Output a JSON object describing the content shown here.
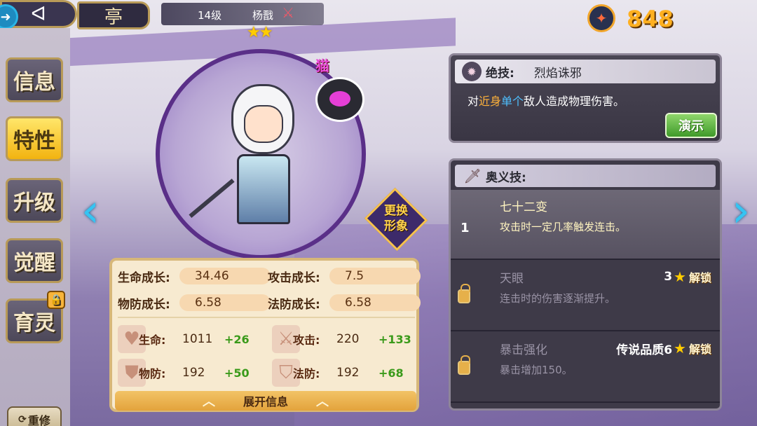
{
  "topbar": {
    "back_arrow": "➜",
    "home_glyph": "ᐊ",
    "building_glyph": "亭",
    "hero_level": "14级",
    "hero_name": "杨戬",
    "stars": "★★",
    "currency_value": "848"
  },
  "left_menu": {
    "items": [
      {
        "label": "信息"
      },
      {
        "label": "特性"
      },
      {
        "label": "升级"
      },
      {
        "label": "觉醒"
      },
      {
        "label": "育灵"
      }
    ],
    "active_index": 1,
    "rebuild_label": "重修"
  },
  "portrait": {
    "pet_tag": "猫",
    "change_look_label": "更换\n形象"
  },
  "stats": {
    "growth": [
      {
        "label": "生命成长:",
        "value": "34.46"
      },
      {
        "label": "攻击成长:",
        "value": "7.5"
      },
      {
        "label": "物防成长:",
        "value": "6.58"
      },
      {
        "label": "法防成长:",
        "value": "6.58"
      }
    ],
    "attributes": [
      {
        "label": "生命:",
        "value": "1011",
        "bonus": "+26",
        "icon": "heart-icon"
      },
      {
        "label": "攻击:",
        "value": "220",
        "bonus": "+133",
        "icon": "sword-icon"
      },
      {
        "label": "物防:",
        "value": "192",
        "bonus": "+50",
        "icon": "shield-icon"
      },
      {
        "label": "法防:",
        "value": "192",
        "bonus": "+68",
        "icon": "magic-shield-icon"
      }
    ],
    "expand_label": "展开信息"
  },
  "skill": {
    "label": "绝技:",
    "name": "烈焰诛邪",
    "desc_prefix": "对",
    "desc_hl1": "近身",
    "desc_hl2": "单个",
    "desc_suffix": "敌人造成物理伤害。",
    "demo_label": "演示"
  },
  "mystic": {
    "label": "奥义技:",
    "items": [
      {
        "index": "1",
        "name": "七十二变",
        "desc": "攻击时一定几率触发连击。",
        "locked": false
      },
      {
        "name": "天眼",
        "desc": "连击时的伤害逐渐提升。",
        "locked": true,
        "req": "3",
        "unlock": "解锁"
      },
      {
        "name": "暴击强化",
        "desc": "暴击增加150。",
        "locked": true,
        "req": "传说品质6",
        "unlock": "解锁"
      }
    ]
  },
  "colors": {
    "accent_gold": "#b89a58",
    "currency": "#ffb020",
    "nav_blue": "#35c4f2",
    "bonus_green": "#3a9a1a"
  }
}
